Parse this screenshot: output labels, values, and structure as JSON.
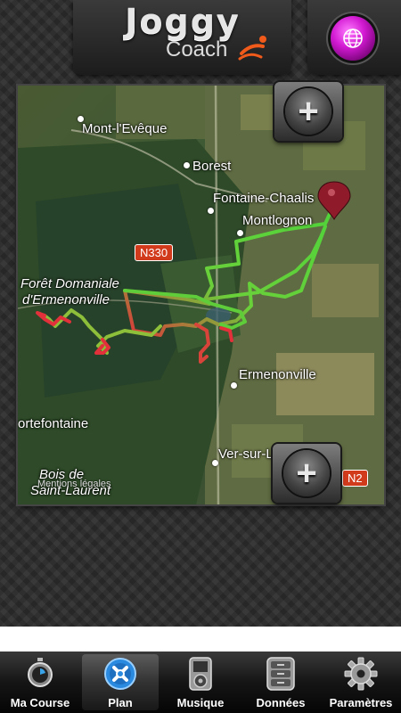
{
  "header": {
    "logo_text": "Joggy",
    "logo_subtitle": "Coach",
    "globe_icon": "globe-icon",
    "globe_color": "#d21ad2"
  },
  "map": {
    "places": [
      {
        "name": "Mont-l'Evêque"
      },
      {
        "name": "Borest"
      },
      {
        "name": "Fontaine-Chaalis"
      },
      {
        "name": "Montlognon"
      },
      {
        "name": "Forêt Domaniale"
      },
      {
        "name": "d'Ermenonville"
      },
      {
        "name": "Ermenonville"
      },
      {
        "name": "ortefontaine"
      },
      {
        "name": "Ver-sur-Launette"
      },
      {
        "name": "Bois de"
      },
      {
        "name": "Saint-Laurent"
      }
    ],
    "road_badges": [
      "N330",
      "N2"
    ],
    "legal_text": "Mentions légales",
    "zoom_in_label": "+",
    "zoom_out_label": "+",
    "route_start_color": "#4fd33a",
    "route_end_color": "#e2313a"
  },
  "tabbar": {
    "tabs": [
      {
        "label": "Ma Course",
        "icon": "stopwatch-icon"
      },
      {
        "label": "Plan",
        "icon": "map-plan-icon",
        "active": true
      },
      {
        "label": "Musique",
        "icon": "music-player-icon"
      },
      {
        "label": "Données",
        "icon": "data-drawers-icon"
      },
      {
        "label": "Paramètres",
        "icon": "gear-icon"
      }
    ]
  }
}
